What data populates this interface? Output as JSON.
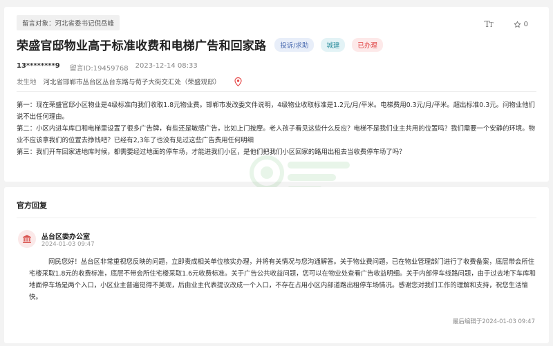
{
  "message": {
    "target": "留言对象：河北省委书记倪岳峰",
    "title": "荣盛官邸物业高于标准收费和电梯广告和回家路",
    "tags": {
      "type": "投诉/求助",
      "domain": "城建",
      "status": "已办理"
    },
    "user": "13********9",
    "message_id": "留言ID:19459768",
    "time": "2023-12-14 08:33",
    "location_label": "发生地",
    "location": "河北省邯郸市丛台区丛台东路与荀子大街交汇处（荣盛观邸）",
    "star_count": "0",
    "paragraphs": [
      "第一：现在荣盛官邸小区物业是4级标准向我们收取1.8元物业费。邯郸市发改委文件说明，4级物业收取标准是1.2元/月/平米。电梯费用0.3元/月/平米。超出标准0.3元。问物业他们说不出任何理由。",
      "第二：小区内进车库口和电梯里设置了很多广告牌，有些还是敏感广告，比如上门按摩。老人孩子看见这些什么反应？电梯不是我们业主共用的位置吗？我们需要一个安静的环境。物业不应该拿我们的位置去挣钱吧？已经有2,3年了也没有见过这些广告费用任何明细",
      "第三：我们开车回家进地库时候，都需要经过地面的停车场，才能进我们小区，是他们把我们小区回家的路用出租去当收费停车场了吗？"
    ]
  },
  "reply": {
    "header": "官方回复",
    "org_name": "丛台区委办公室",
    "time": "2024-01-03 09:47",
    "text": "网民您好！丛台区非常重视您反映的问题，立即责成相关单位核实办理，并将有关情况与您沟通解答。关于物业费问题，已在物业管理部门进行了收费备案，底层带会所住宅楼采取1.8元的收费标准，底层不带会所住宅楼采取1.6元收费标准。关于广告公共收益问题，您可以在物业处查看广告收益明细。关于内部停车线路问题，由于过去地下车库和地面停车场是两个入口，小区业主普遍觉得不美观，后由业主代表提议改成一个入口，不存在占用小区内部道路出租停车场情况。感谢您对我们工作的理解和支持，祝您生活愉快。",
    "edited": "最后编辑于2024-01-03 09:47"
  },
  "icons": {
    "font_size": "font-size-icon",
    "star": "star-icon",
    "pin": "location-pin-icon",
    "org": "government-building-icon"
  },
  "colors": {
    "status_red": "#e04646",
    "type_blue": "#4a6bb0",
    "domain_teal": "#2a8c9c",
    "pin_red": "#e64b4b"
  }
}
